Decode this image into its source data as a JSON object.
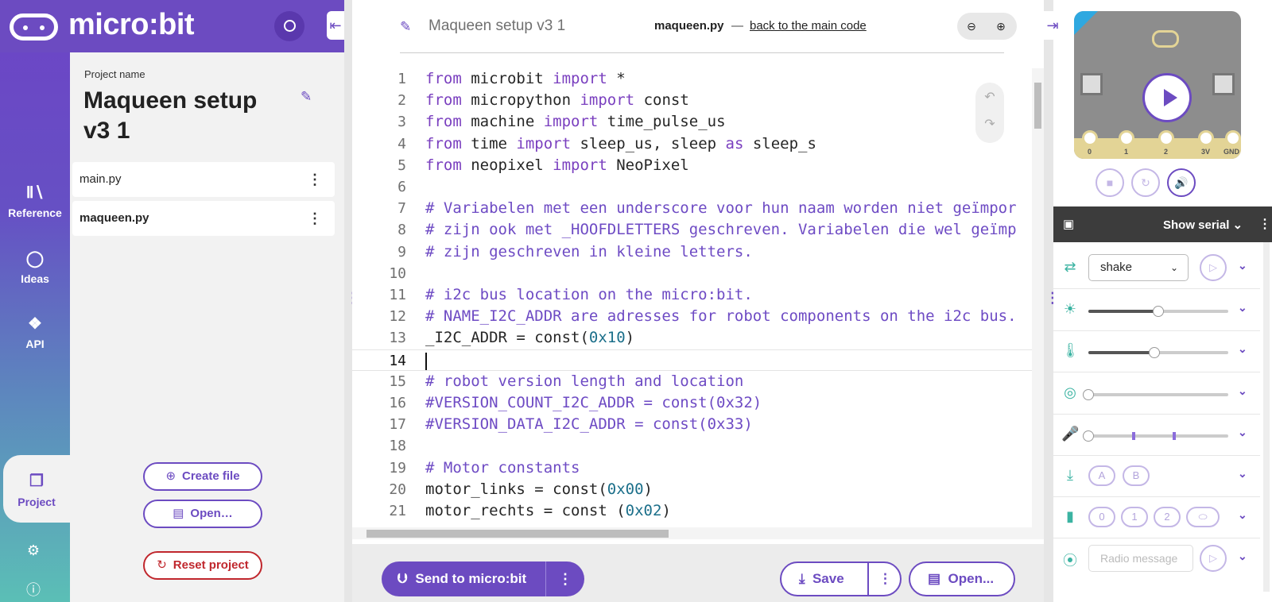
{
  "brand": {
    "name": "micro:bit"
  },
  "rail": {
    "items": [
      {
        "label": "Reference",
        "icon": "library-icon"
      },
      {
        "label": "Ideas",
        "icon": "lightbulb-icon"
      },
      {
        "label": "API",
        "icon": "python-icon"
      },
      {
        "label": "Project",
        "icon": "files-icon"
      }
    ],
    "bottom_icons": [
      "settings-icon",
      "help-icon"
    ]
  },
  "project": {
    "label": "Project name",
    "name": "Maqueen setup v3 1",
    "files": [
      {
        "name": "main.py",
        "active": false
      },
      {
        "name": "maqueen.py",
        "active": true
      }
    ],
    "create_file": "Create file",
    "open": "Open…",
    "reset": "Reset project"
  },
  "editor": {
    "project_title": "Maqueen setup v3 1",
    "current_file": "maqueen.py",
    "separator": "—",
    "back_link": "back to the main code",
    "active_line": 14,
    "lines": [
      {
        "n": "1",
        "text": "from microbit import *"
      },
      {
        "n": "2",
        "text": "from micropython import const"
      },
      {
        "n": "3",
        "text": "from machine import time_pulse_us"
      },
      {
        "n": "4",
        "text": "from time import sleep_us, sleep as sleep_s"
      },
      {
        "n": "5",
        "text": "from neopixel import NeoPixel"
      },
      {
        "n": "6",
        "text": ""
      },
      {
        "n": "7",
        "text": "# Variabelen met een underscore voor hun naam worden niet geïmpor"
      },
      {
        "n": "8",
        "text": "# zijn ook met _HOOFDLETTERS geschreven. Variabelen die wel geïmp"
      },
      {
        "n": "9",
        "text": "# zijn geschreven in kleine letters."
      },
      {
        "n": "10",
        "text": ""
      },
      {
        "n": "11",
        "text": "# i2c bus location on the micro:bit."
      },
      {
        "n": "12",
        "text": "# NAME_I2C_ADDR are adresses for robot components on the i2c bus."
      },
      {
        "n": "13",
        "text": "_I2C_ADDR = const(0x10)"
      },
      {
        "n": "14",
        "text": ""
      },
      {
        "n": "15",
        "text": "# robot version length and location"
      },
      {
        "n": "16",
        "text": "#VERSION_COUNT_I2C_ADDR = const(0x32)"
      },
      {
        "n": "17",
        "text": "#VERSION_DATA_I2C_ADDR = const(0x33)"
      },
      {
        "n": "18",
        "text": ""
      },
      {
        "n": "19",
        "text": "# Motor constants"
      },
      {
        "n": "20",
        "text": "motor_links = const(0x00)"
      },
      {
        "n": "21",
        "text": "motor_rechts = const (0x02)"
      }
    ],
    "send": "Send to micro:bit",
    "save": "Save",
    "open": "Open..."
  },
  "simulator": {
    "pins": [
      "0",
      "1",
      "2",
      "3V",
      "GND"
    ],
    "serial_label": "Show serial",
    "gesture": "shake",
    "buttons": [
      "A",
      "B"
    ],
    "touch_pins": [
      "0",
      "1",
      "2"
    ],
    "radio_placeholder": "Radio message",
    "light_level": 0.5,
    "temperature_level": 0.47,
    "compass_level": 0.0,
    "sound_level": 0.0
  },
  "colors": {
    "accent": "#6c4bc1",
    "teal": "#3bb3a2",
    "danger": "#c0272d"
  }
}
